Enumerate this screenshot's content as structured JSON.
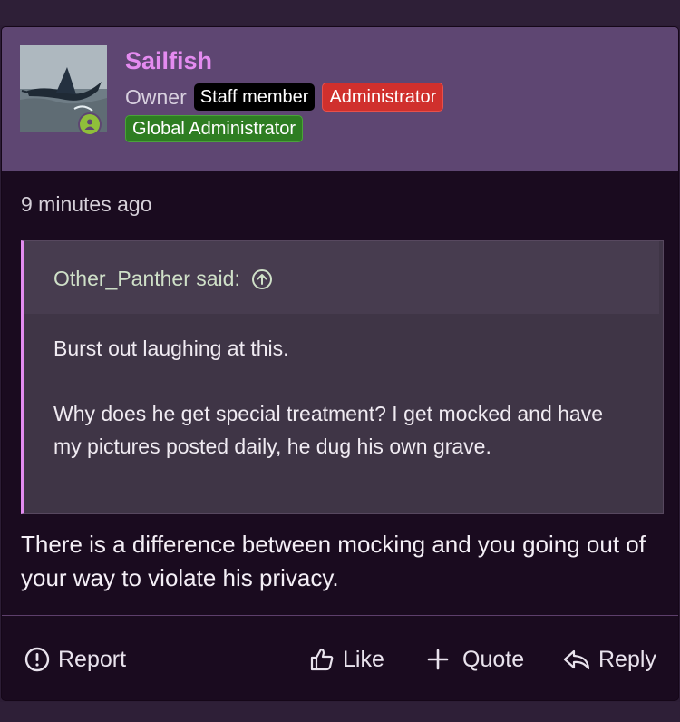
{
  "author": {
    "name": "Sailfish",
    "title": "Owner",
    "badges": {
      "staff": "Staff member",
      "admin": "Administrator",
      "global": "Global Administrator"
    },
    "online_color": "#8fbf3a"
  },
  "post": {
    "time": "9 minutes ago",
    "quote": {
      "author_line": "Other_Panther said:",
      "paragraphs": [
        "Burst out laughing at this.",
        "Why does he get special treatment? I get mocked and have my pictures posted daily, he dug his own grave."
      ]
    },
    "body": "There is a difference between mocking and you going out of your way to violate his privacy."
  },
  "actions": {
    "report": "Report",
    "like": "Like",
    "quote": "Quote",
    "reply": "Reply"
  },
  "colors": {
    "accent": "#e48bf0",
    "header_bg": "#5e4672",
    "post_bg": "#1a0b1f"
  }
}
